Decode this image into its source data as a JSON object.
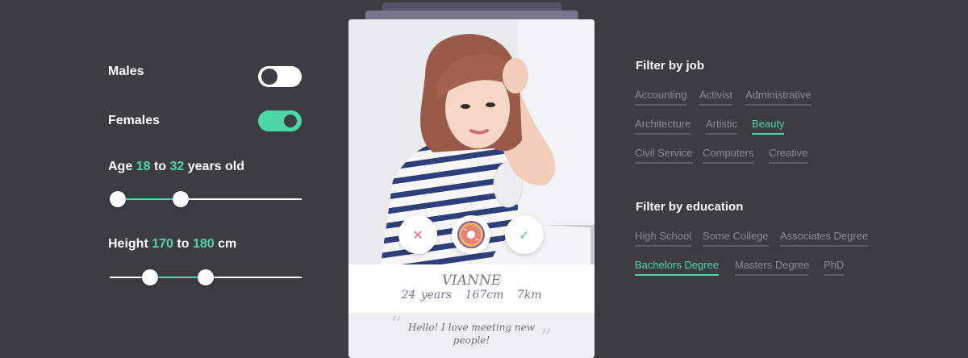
{
  "filters": {
    "males": {
      "label": "Males",
      "enabled": false
    },
    "females": {
      "label": "Females",
      "enabled": true
    },
    "age": {
      "prefix": "Age",
      "min": "18",
      "sep": "to",
      "max": "32",
      "suffix": "years old",
      "range_fraction": [
        0.04,
        0.37
      ]
    },
    "height": {
      "prefix": "Height",
      "min": "170",
      "sep": "to",
      "max": "180",
      "suffix": "cm",
      "range_fraction": [
        0.21,
        0.5
      ]
    }
  },
  "card": {
    "name": "VIANNE",
    "age": "24 years",
    "height": "167cm",
    "distance": "7km",
    "bio": "Hello! I love meeting new people!",
    "actions": {
      "dislike_icon": "close-icon",
      "middle_icon": "donut-icon",
      "like_icon": "check-icon"
    }
  },
  "job_filter": {
    "title": "Filter by job",
    "options": [
      "Accounting",
      "Activist",
      "Administrative",
      "Architecture",
      "Artistic",
      "Beauty",
      "Civil Service",
      "Computers",
      "Creative"
    ],
    "active": "Beauty"
  },
  "education_filter": {
    "title": "Filter by education",
    "options": [
      "High School",
      "Some College",
      "Associates Degree",
      "Bachelors Degree",
      "Masters Degree",
      "PhD"
    ],
    "active": "Bachelors Degree"
  },
  "colors": {
    "accent": "#4dd6a8",
    "background": "#3d3c42",
    "muted": "#8b8a98",
    "dislike": "#e06b6b"
  }
}
